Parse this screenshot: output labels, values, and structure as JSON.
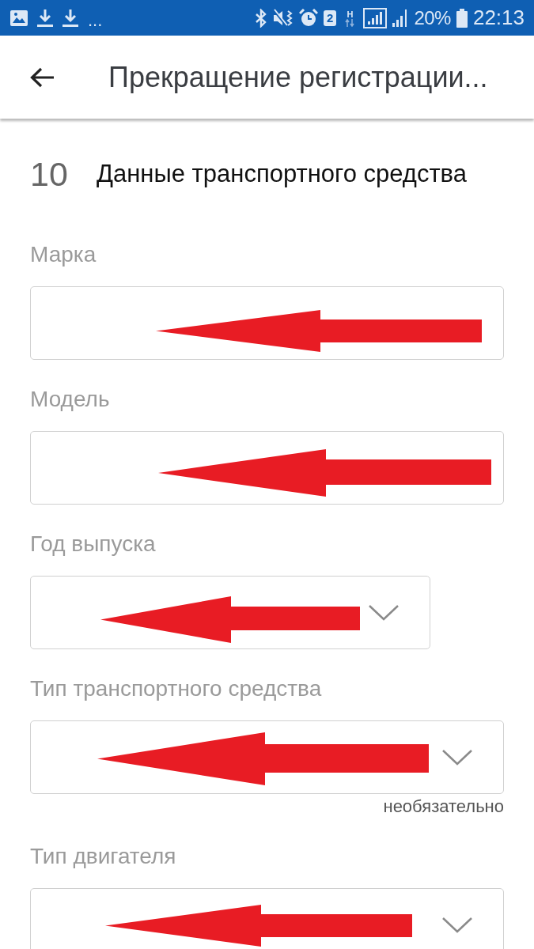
{
  "status_bar": {
    "overflow": "...",
    "sim_slot": "2",
    "network_type": "H",
    "battery": "20%",
    "time": "22:13"
  },
  "app_bar": {
    "title": "Прекращение регистрации..."
  },
  "section": {
    "number": "10",
    "title": "Данные транспортного средства"
  },
  "fields": [
    {
      "label": "Марка",
      "kind": "text",
      "arrow": true
    },
    {
      "label": "Модель",
      "kind": "text",
      "arrow": true
    },
    {
      "label": "Год выпуска",
      "kind": "short-select",
      "arrow": true
    },
    {
      "label": "Тип транспортного средства",
      "kind": "select",
      "arrow": true,
      "hint": "необязательно"
    },
    {
      "label": "Тип двигателя",
      "kind": "select",
      "arrow": true
    }
  ]
}
